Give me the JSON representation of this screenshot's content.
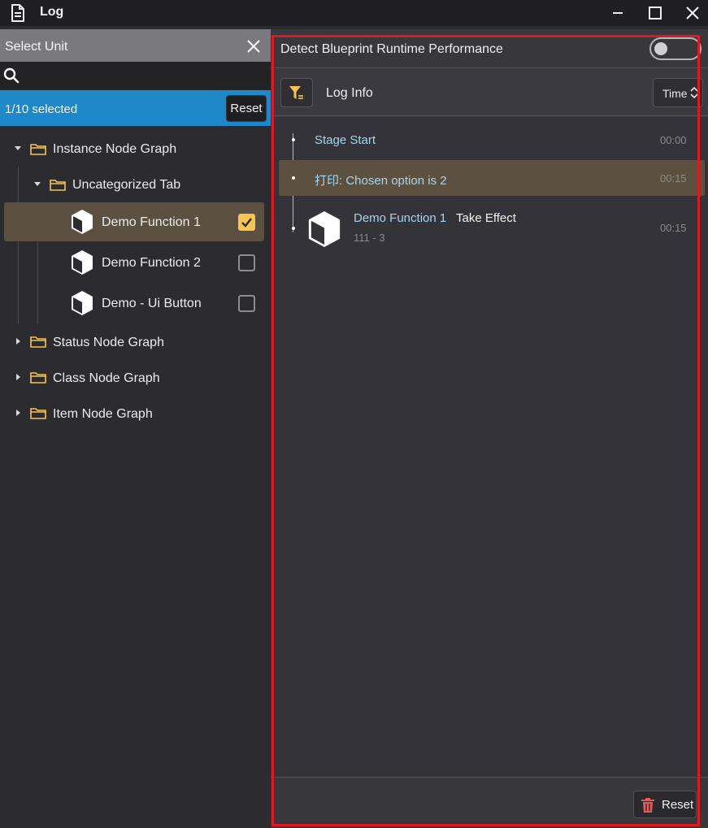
{
  "window": {
    "title": "Log"
  },
  "icons": {
    "document": "document-icon",
    "minimize": "minimize-icon",
    "maximize": "maximize-icon",
    "close": "close-icon",
    "search": "search-icon",
    "filter": "filter-icon",
    "sort": "sort-arrows-icon",
    "trash": "trash-icon",
    "cube": "cube-icon",
    "folder": "folder-icon"
  },
  "colors": {
    "accent_blue": "#1e88c8",
    "check_yellow": "#f5c451",
    "highlight_frame": "#e0191f",
    "log_blue_text": "#a8d4ec",
    "selected_row": "#5c5140",
    "delete_red": "#e85a5a"
  },
  "left_panel": {
    "header_label": "Select Unit",
    "search_placeholder": "",
    "selection_count": "1/10 selected",
    "reset_label": "Reset",
    "tree": {
      "groups": [
        {
          "label": "Instance Node Graph",
          "expanded": true,
          "subgroups": [
            {
              "label": "Uncategorized Tab",
              "expanded": true,
              "items": [
                {
                  "label": "Demo Function 1",
                  "checked": true,
                  "selected": true
                },
                {
                  "label": "Demo Function 2",
                  "checked": false,
                  "selected": false
                },
                {
                  "label": "Demo - Ui Button",
                  "checked": false,
                  "selected": false
                }
              ]
            }
          ]
        },
        {
          "label": "Status Node Graph",
          "expanded": false
        },
        {
          "label": "Class Node Graph",
          "expanded": false
        },
        {
          "label": "Item Node Graph",
          "expanded": false
        }
      ]
    }
  },
  "right_panel": {
    "perf_label": "Detect Blueprint Runtime Performance",
    "perf_toggle_on": false,
    "log_title": "Log Info",
    "sort_label": "Time",
    "entries": [
      {
        "text": "Stage Start",
        "time": "00:00"
      },
      {
        "text": "打印: Chosen option is 2",
        "time": "00:15",
        "highlighted": true
      },
      {
        "name": "Demo Function 1",
        "action": "Take Effect",
        "detail": "111 - 3",
        "time": "00:15"
      }
    ],
    "reset_label": "Reset"
  }
}
